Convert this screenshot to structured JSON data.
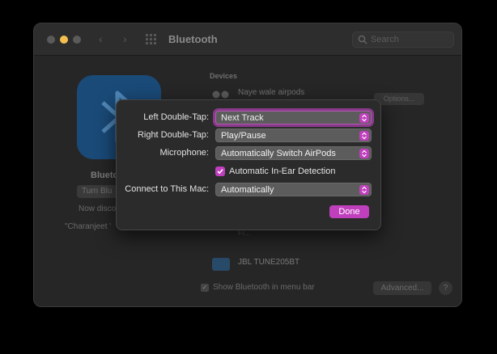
{
  "window": {
    "title": "Bluetooth",
    "search_placeholder": "Search"
  },
  "background": {
    "bt_label": "Blueto",
    "turn_button": "Turn Blu",
    "now_text": "Now disco",
    "name_text": "\"Charanjeet '",
    "devices_header": "Devices",
    "device1_name": "Naye wale airpods",
    "options_button": "Options...",
    "faded_text": "Fi...",
    "device2_name": "JBL TUNE205BT",
    "show_in_menu_bar": "Show Bluetooth in menu bar",
    "advanced_button": "Advanced...",
    "help_button": "?"
  },
  "sheet": {
    "left_double_tap": {
      "label": "Left Double-Tap:",
      "value": "Next Track"
    },
    "right_double_tap": {
      "label": "Right Double-Tap:",
      "value": "Play/Pause"
    },
    "microphone": {
      "label": "Microphone:",
      "value": "Automatically Switch AirPods"
    },
    "ear_detection": {
      "label": "Automatic In-Ear Detection",
      "checked": true
    },
    "connect": {
      "label": "Connect to This Mac:",
      "value": "Automatically"
    },
    "done_button": "Done"
  },
  "colors": {
    "accent": "#c03fbd",
    "bluetooth_tile": "#1a4a78"
  }
}
